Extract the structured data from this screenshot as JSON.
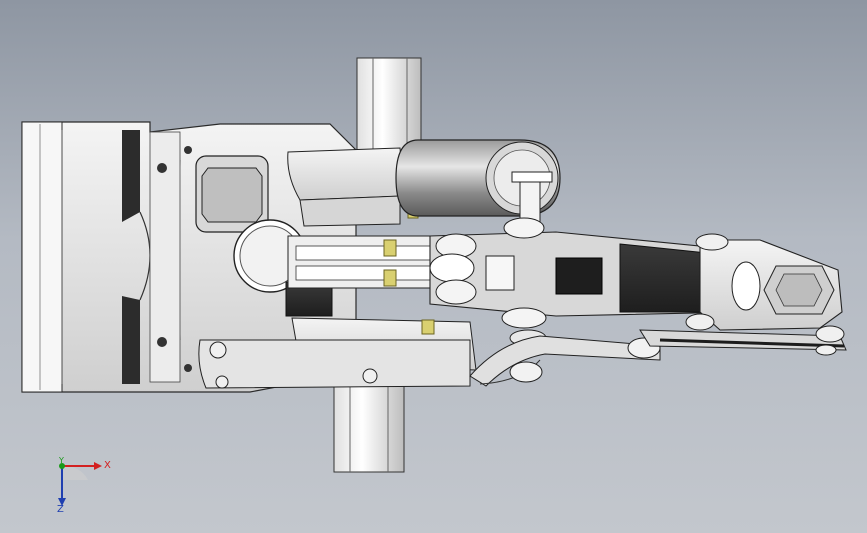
{
  "viewport": {
    "background_top": "#8e96a2",
    "background_bottom": "#c3c7cd"
  },
  "model": {
    "description_icon": "cad-gripper-assembly-icon"
  },
  "triad": {
    "x_label": "X",
    "y_label": "Y",
    "z_label": "Z",
    "x_color": "#d32020",
    "y_color": "#1a9a1a",
    "z_color": "#1f3fb0"
  }
}
